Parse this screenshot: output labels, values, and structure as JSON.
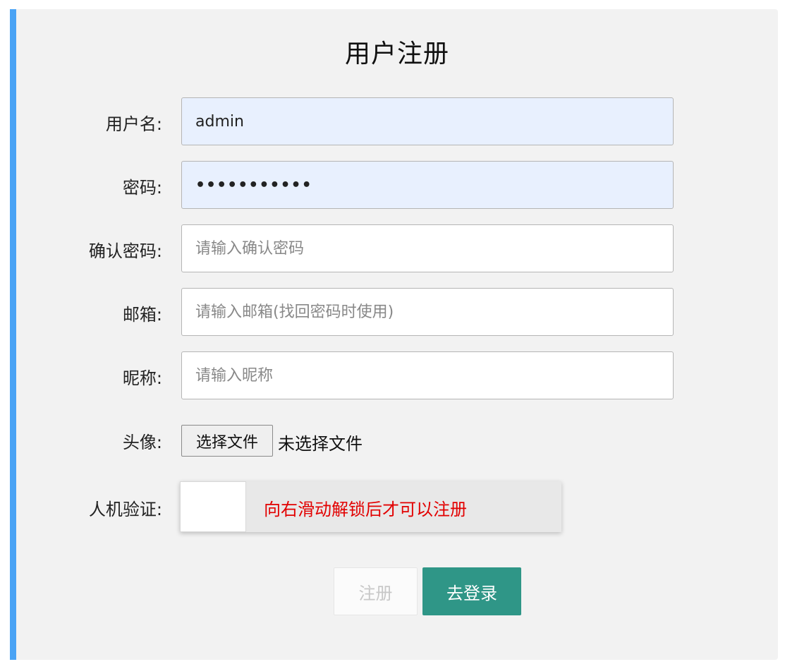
{
  "form": {
    "title": "用户注册",
    "username": {
      "label": "用户名:",
      "value": "admin",
      "placeholder": ""
    },
    "password": {
      "label": "密码:",
      "value": "•••••••••••",
      "placeholder": ""
    },
    "confirm_password": {
      "label": "确认密码:",
      "value": "",
      "placeholder": "请输入确认密码"
    },
    "email": {
      "label": "邮箱:",
      "value": "",
      "placeholder": "请输入邮箱(找回密码时使用)"
    },
    "nickname": {
      "label": "昵称:",
      "value": "",
      "placeholder": "请输入昵称"
    },
    "avatar": {
      "label": "头像:",
      "button_label": "选择文件",
      "status": "未选择文件"
    },
    "captcha": {
      "label": "人机验证:",
      "slider_text": "向右滑动解锁后才可以注册",
      "progress": 0
    },
    "buttons": {
      "register": "注册",
      "login": "去登录"
    }
  },
  "colors": {
    "accent_bar": "#4aa3f5",
    "panel_bg": "#f2f2f2",
    "autofill_bg": "#e8f0fe",
    "warning_text": "#e20000",
    "login_button": "#2f9687",
    "register_disabled_text": "#c8c8c8"
  }
}
